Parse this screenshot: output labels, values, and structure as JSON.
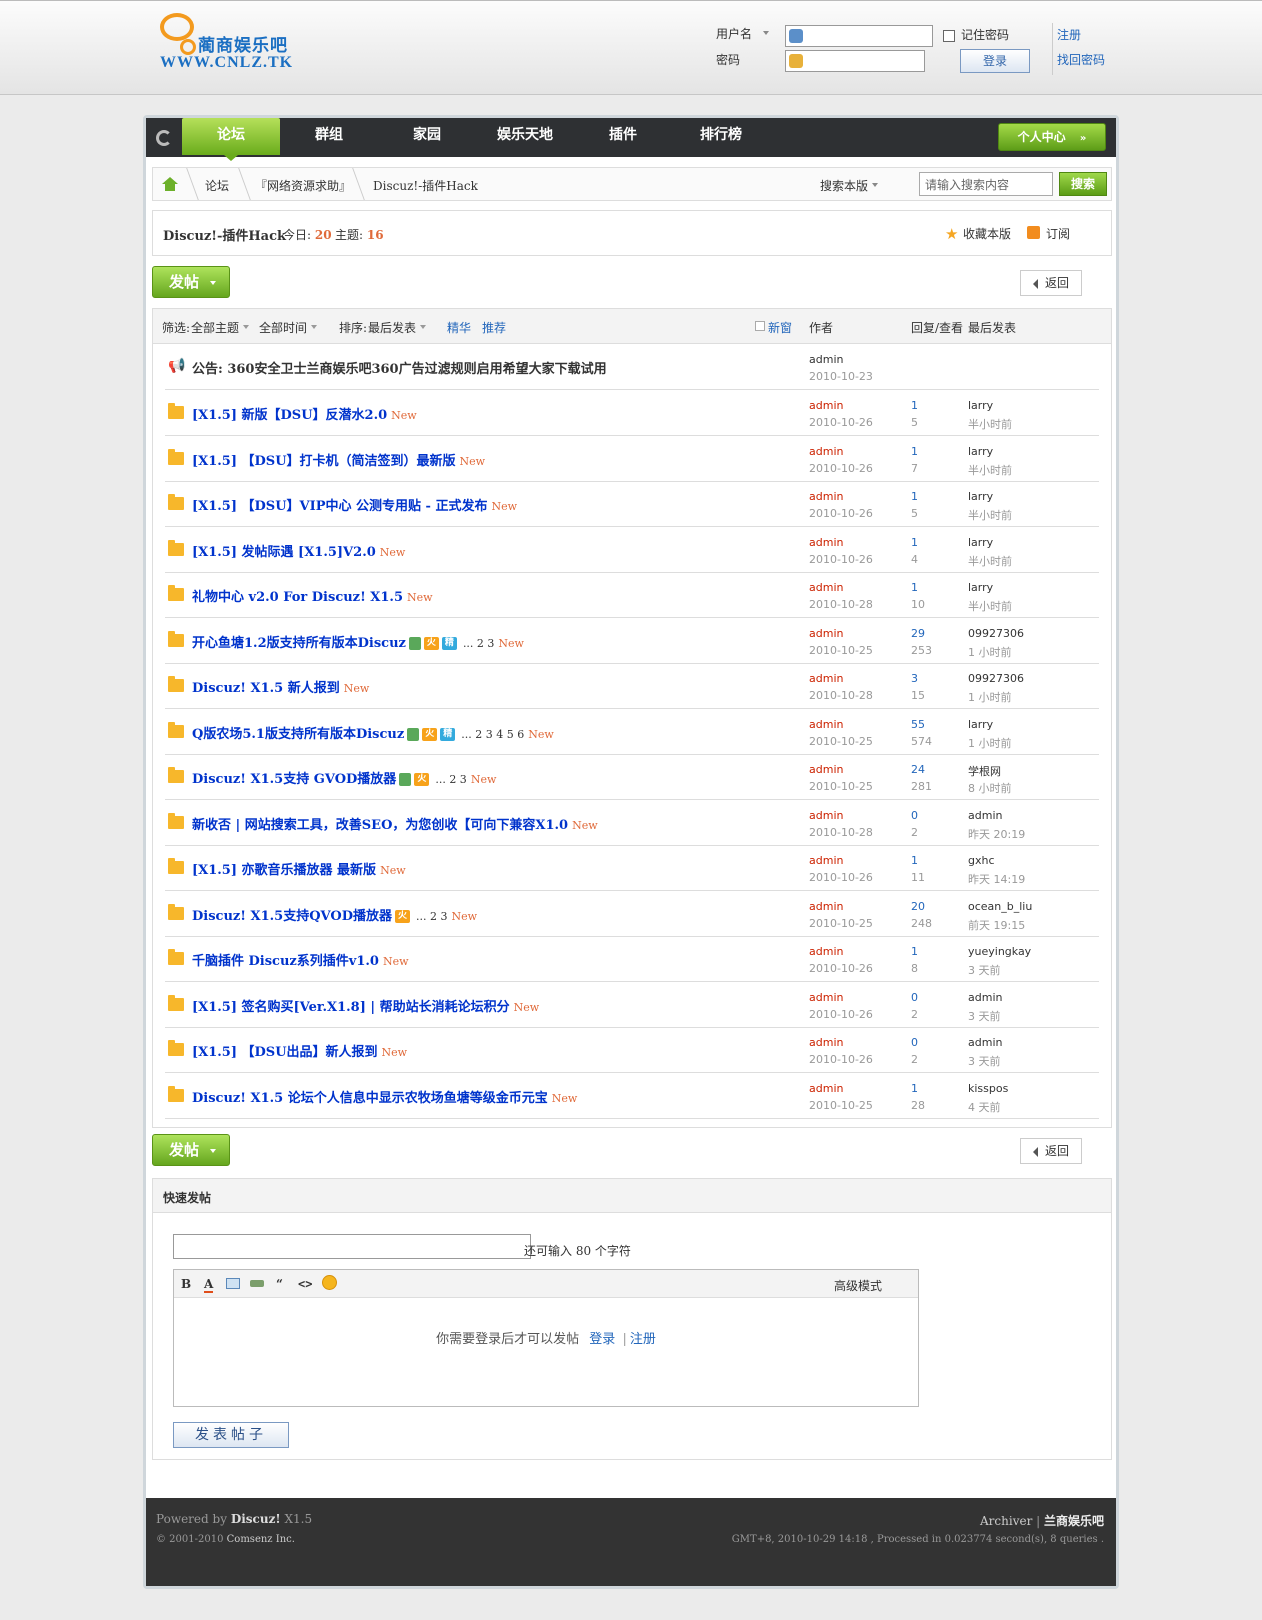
{
  "header": {
    "logo_name": "蔺商娱乐吧",
    "logo_url": "WWW.CNLZ.TK",
    "username_label": "用户名",
    "password_label": "密码",
    "remember_label": "记住密码",
    "login_button": "登录",
    "register_link": "注册",
    "forgot_link": "找回密码"
  },
  "nav": {
    "items": [
      "论坛",
      "群组",
      "家园",
      "娱乐天地",
      "插件",
      "排行榜"
    ],
    "active": "论坛",
    "user_center": "个人中心"
  },
  "breadcrumb": {
    "items": [
      "论坛",
      "『网络资源求助』",
      "Discuz!-插件Hack"
    ],
    "search_scope": "搜索本版",
    "search_placeholder": "请输入搜索内容",
    "search_button": "搜索"
  },
  "forum": {
    "name": "Discuz!-插件Hack",
    "today_label": "今日:",
    "today_count": "20",
    "threads_label": "主题:",
    "threads_count": "16",
    "favorite": "收藏本版",
    "subscribe": "订阅"
  },
  "actions": {
    "post_button": "发帖",
    "back_button": "返回"
  },
  "list_header": {
    "filter_label": "筛选:",
    "filter_all": "全部主题",
    "time_all": "全部时间",
    "sort_label": "排序:",
    "sort_value": "最后发表",
    "digest": "精华",
    "recommend": "推荐",
    "new_window": "新窗",
    "author": "作者",
    "reply_view": "回复/查看",
    "last_post": "最后发表"
  },
  "announcement": {
    "title": "公告: 360安全卫士兰商娱乐吧360广告过滤规则启用希望大家下载试用",
    "author": "admin",
    "date": "2010-10-23"
  },
  "threads": [
    {
      "title": "[X1.5] 新版【DSU】反潜水2.0",
      "badges": [],
      "pages": "",
      "author": "admin",
      "date": "2010-10-26",
      "replies": "1",
      "views": "5",
      "last_user": "larry",
      "last_time": "半小时前"
    },
    {
      "title": "[X1.5] 【DSU】打卡机（简洁签到）最新版",
      "badges": [],
      "pages": "",
      "author": "admin",
      "date": "2010-10-26",
      "replies": "1",
      "views": "7",
      "last_user": "larry",
      "last_time": "半小时前"
    },
    {
      "title": "[X1.5] 【DSU】VIP中心  公测专用贴  - 正式发布",
      "badges": [],
      "pages": "",
      "author": "admin",
      "date": "2010-10-26",
      "replies": "1",
      "views": "5",
      "last_user": "larry",
      "last_time": "半小时前"
    },
    {
      "title": "[X1.5] 发帖际遇   [X1.5]V2.0",
      "badges": [],
      "pages": "",
      "author": "admin",
      "date": "2010-10-26",
      "replies": "1",
      "views": "4",
      "last_user": "larry",
      "last_time": "半小时前"
    },
    {
      "title": "礼物中心  v2.0 For Discuz! X1.5",
      "badges": [],
      "pages": "",
      "author": "admin",
      "date": "2010-10-28",
      "replies": "1",
      "views": "10",
      "last_user": "larry",
      "last_time": "半小时前"
    },
    {
      "title": "开心鱼塘1.2版支持所有版本Discuz",
      "badges": [
        "img",
        "火",
        "精"
      ],
      "pages": "... 2  3",
      "author": "admin",
      "date": "2010-10-25",
      "replies": "29",
      "views": "253",
      "last_user": "09927306",
      "last_time": "1 小时前"
    },
    {
      "title": "Discuz! X1.5 新人报到",
      "badges": [],
      "pages": "",
      "author": "admin",
      "date": "2010-10-28",
      "replies": "3",
      "views": "15",
      "last_user": "09927306",
      "last_time": "1 小时前"
    },
    {
      "title": "Q版农场5.1版支持所有版本Discuz",
      "badges": [
        "img",
        "火",
        "精"
      ],
      "pages": "... 2  3  4  5  6",
      "author": "admin",
      "date": "2010-10-25",
      "replies": "55",
      "views": "574",
      "last_user": "larry",
      "last_time": "1 小时前"
    },
    {
      "title": "Discuz! X1.5支持  GVOD播放器",
      "badges": [
        "img",
        "火"
      ],
      "pages": "... 2  3",
      "author": "admin",
      "date": "2010-10-25",
      "replies": "24",
      "views": "281",
      "last_user": "学根网",
      "last_time": "8 小时前"
    },
    {
      "title": "新收否  | 网站搜索工具，改善SEO，为您创收【可向下兼容X1.0",
      "badges": [],
      "pages": "",
      "author": "admin",
      "date": "2010-10-28",
      "replies": "0",
      "views": "2",
      "last_user": "admin",
      "last_time": "昨天 20:19"
    },
    {
      "title": "[X1.5] 亦歌音乐播放器  最新版",
      "badges": [],
      "pages": "",
      "author": "admin",
      "date": "2010-10-26",
      "replies": "1",
      "views": "11",
      "last_user": "gxhc",
      "last_time": "昨天 14:19"
    },
    {
      "title": "Discuz! X1.5支持QVOD播放器",
      "badges": [
        "火"
      ],
      "pages": "... 2  3",
      "author": "admin",
      "date": "2010-10-25",
      "replies": "20",
      "views": "248",
      "last_user": "ocean_b_liu",
      "last_time": "前天 19:15"
    },
    {
      "title": "千脑插件  Discuz系列插件v1.0",
      "badges": [],
      "pages": "",
      "author": "admin",
      "date": "2010-10-26",
      "replies": "1",
      "views": "8",
      "last_user": "yueyingkay",
      "last_time": "3 天前"
    },
    {
      "title": "[X1.5] 签名购买[Ver.X1.8] | 帮助站长消耗论坛积分",
      "badges": [],
      "pages": "",
      "author": "admin",
      "date": "2010-10-26",
      "replies": "0",
      "views": "2",
      "last_user": "admin",
      "last_time": "3 天前"
    },
    {
      "title": "[X1.5] 【DSU出品】新人报到",
      "badges": [],
      "pages": "",
      "author": "admin",
      "date": "2010-10-26",
      "replies": "0",
      "views": "2",
      "last_user": "admin",
      "last_time": "3 天前"
    },
    {
      "title": "Discuz! X1.5 论坛个人信息中显示农牧场鱼塘等级金币元宝",
      "badges": [],
      "pages": "",
      "author": "admin",
      "date": "2010-10-25",
      "replies": "1",
      "views": "28",
      "last_user": "kisspos",
      "last_time": "4 天前"
    }
  ],
  "new_tag": "New",
  "quick_post": {
    "title": "快速发帖",
    "char_hint": "还可输入  80 个字符",
    "advanced": "高级模式",
    "need_login": "你需要登录后才可以发帖",
    "login": "登录",
    "register": "注册",
    "submit": "发表帖子"
  },
  "footer": {
    "powered_prefix": "Powered by",
    "powered_brand": "Discuz!",
    "powered_version": "X1.5",
    "copyright": "© 2001-2010",
    "company": "Comsenz Inc.",
    "archiver": "Archiver",
    "site_name": "兰商娱乐吧",
    "debug": "GMT+8, 2010-10-29 14:18 , Processed in 0.023774 second(s), 8 queries ."
  },
  "colors": {
    "accent_green": "#6aac1c",
    "nav_dark": "#2e3033",
    "link_blue": "#0033cc",
    "author_red": "#cc2200",
    "new_orange": "#e06a3a"
  }
}
